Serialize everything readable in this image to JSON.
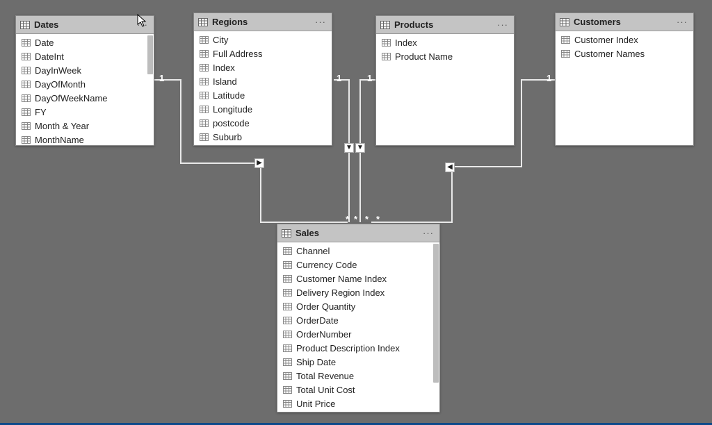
{
  "tables": {
    "dates": {
      "name": "Dates",
      "fields": [
        "Date",
        "DateInt",
        "DayInWeek",
        "DayOfMonth",
        "DayOfWeekName",
        "FY",
        "Month & Year",
        "MonthName"
      ]
    },
    "regions": {
      "name": "Regions",
      "fields": [
        "City",
        "Full Address",
        "Index",
        "Island",
        "Latitude",
        "Longitude",
        "postcode",
        "Suburb"
      ]
    },
    "products": {
      "name": "Products",
      "fields": [
        "Index",
        "Product Name"
      ]
    },
    "customers": {
      "name": "Customers",
      "fields": [
        "Customer Index",
        "Customer Names"
      ]
    },
    "sales": {
      "name": "Sales",
      "fields": [
        "Channel",
        "Currency Code",
        "Customer Name Index",
        "Delivery Region Index",
        "Order Quantity",
        "OrderDate",
        "OrderNumber",
        "Product Description Index",
        "Ship Date",
        "Total Revenue",
        "Total Unit Cost",
        "Unit Price"
      ]
    }
  },
  "relationships": [
    {
      "from": "dates",
      "to": "sales",
      "fromCard": "1",
      "toCard": "*"
    },
    {
      "from": "regions",
      "to": "sales",
      "fromCard": "1",
      "toCard": "*"
    },
    {
      "from": "products",
      "to": "sales",
      "fromCard": "1",
      "toCard": "*"
    },
    {
      "from": "customers",
      "to": "sales",
      "fromCard": "1",
      "toCard": "*"
    }
  ],
  "ui": {
    "more": "···"
  },
  "colors": {
    "canvas": "#6d6d6d",
    "cardHeader": "#c4c4c4",
    "cardBg": "#ffffff",
    "line": "#f4f4f4",
    "footer": "#0e4a8a"
  }
}
